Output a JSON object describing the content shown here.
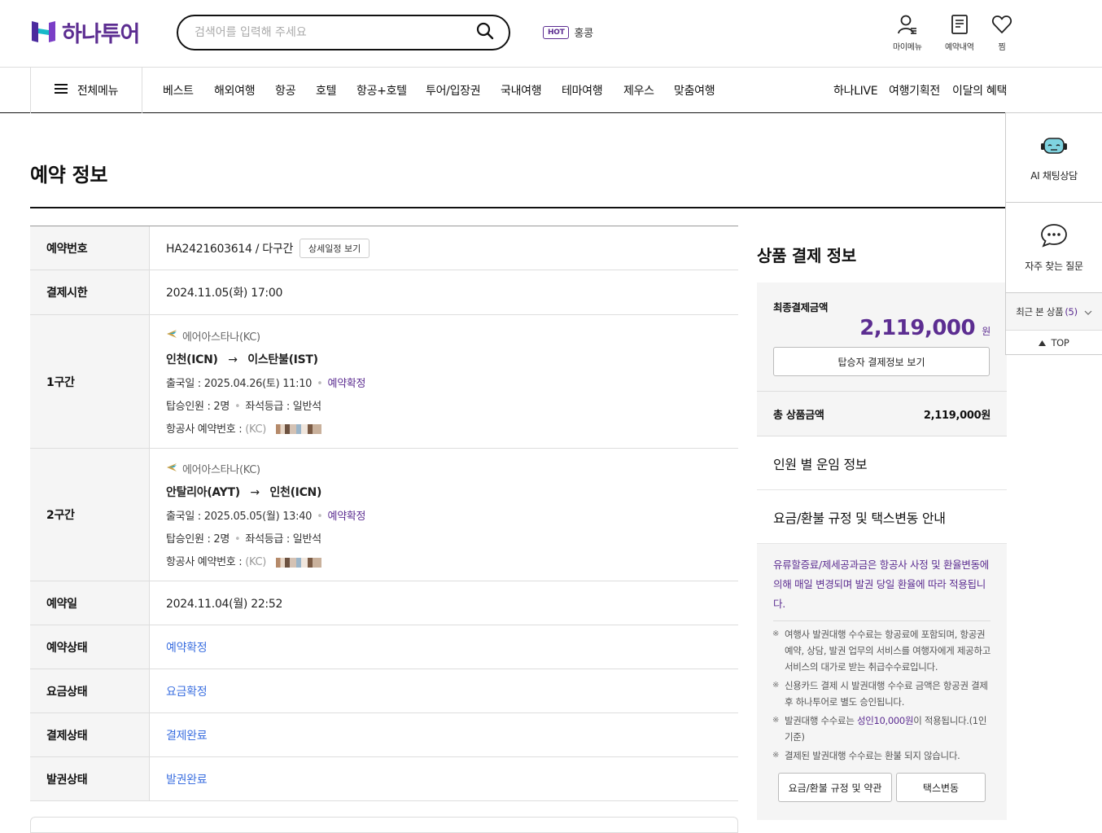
{
  "brand": {
    "logo_text": "하나투어",
    "color": "#5c2d91"
  },
  "search": {
    "placeholder": "검색어를 입력해 주세요",
    "icon": "search-icon"
  },
  "hot": {
    "badge": "HOT",
    "keyword": "홍콩"
  },
  "top_icons": [
    {
      "label": "마이메뉴",
      "icon": "user-icon"
    },
    {
      "label": "예약내역",
      "icon": "document-icon"
    },
    {
      "label": "찜",
      "icon": "heart-icon"
    }
  ],
  "nav": {
    "all_menu": "전체메뉴",
    "items": [
      "베스트",
      "해외여행",
      "항공",
      "호텔",
      "항공+호텔",
      "투어/입장권",
      "국내여행",
      "테마여행",
      "제우스",
      "맞춤여행"
    ],
    "right_items": [
      "하나LIVE",
      "여행기획전",
      "이달의 혜택"
    ]
  },
  "page_title": "예약 정보",
  "reservation": {
    "number_label": "예약번호",
    "number_value": "HA2421603614 / 다구간",
    "detail_button": "상세일정 보기",
    "paytime_label": "결제시한",
    "paytime_value": "2024.11.05(화) 17:00",
    "segments": [
      {
        "label": "1구간",
        "airline": "에어아스타나(KC)",
        "from": "인천(ICN)",
        "arrow": "→",
        "to": "이스탄불(IST)",
        "depart": "출국일 : 2025.04.26(토) 11:10",
        "status": "예약확정",
        "pax": "탑승인원 : 2명",
        "seat": "좌석등급 : 일반석",
        "pnr_label": "항공사 예약번호 :",
        "pnr_prefix": "(KC)"
      },
      {
        "label": "2구간",
        "airline": "에어아스타나(KC)",
        "from": "안탈리아(AYT)",
        "arrow": "→",
        "to": "인천(ICN)",
        "depart": "출국일 : 2025.05.05(월) 13:40",
        "status": "예약확정",
        "pax": "탑승인원 : 2명",
        "seat": "좌석등급 : 일반석",
        "pnr_label": "항공사 예약번호 :",
        "pnr_prefix": "(KC)"
      }
    ],
    "booked_label": "예약일",
    "booked_value": "2024.11.04(월) 22:52",
    "status_rows": [
      {
        "label": "예약상태",
        "value": "예약확정"
      },
      {
        "label": "요금상태",
        "value": "요금확정"
      },
      {
        "label": "결제상태",
        "value": "결제완료"
      },
      {
        "label": "발권상태",
        "value": "발권완료"
      }
    ]
  },
  "payment": {
    "title": "상품 결제 정보",
    "final_label": "최종결제금액",
    "final_amount": "2,119,000",
    "currency": "원",
    "passenger_button": "탑승자 결제정보 보기",
    "total_label": "총 상품금액",
    "total_value": "2,119,000원",
    "accordion": [
      "인원 별 운임 정보",
      "요금/환불 규정 및 택스변동 안내"
    ],
    "notice": "유류할증료/제세공과금은 항공사 사정 및 환율변동에 의해 매일 변경되며 발권 당일 환율에 따라 적용됩니다.",
    "bullets": [
      "여행사 발권대행 수수료는 항공료에 포함되며, 항공권 예약, 상담, 발권 업무의 서비스를 여행자에게 제공하고 서비스의 대가로 받는 취급수수료입니다.",
      "신용카드 결제 시 발권대행 수수료 금액은 항공권 결제 후 하나투어로 별도 승인됩니다.",
      "결제된 발권대행 수수료는 환불 되지 않습니다."
    ],
    "bullet3_pre": "발권대행 수수료는 ",
    "bullet3_hl": "성인10,000원",
    "bullet3_post": "이 적용됩니다.(1인 기준)",
    "btn_rules": "요금/환불 규정 및 약관",
    "btn_tax": "택스변동"
  },
  "side": {
    "ai_chat": "AI 채팅상담",
    "faq": "자주 찾는 질문",
    "recent_label": "최근 본 상품",
    "recent_count": "(5)",
    "top": "TOP"
  }
}
